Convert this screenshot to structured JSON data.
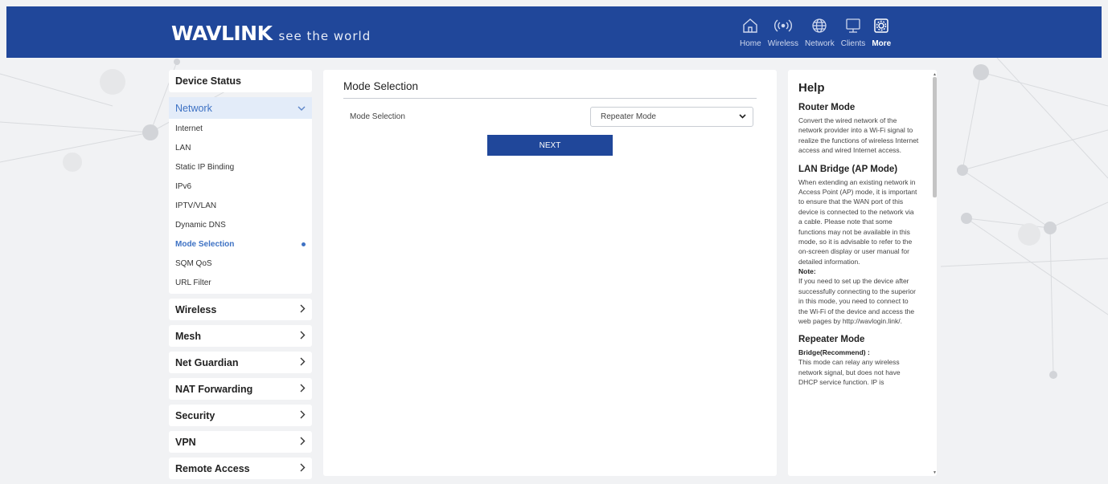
{
  "header": {
    "brand": "WAVLINK",
    "tagline": "see the world",
    "nav": [
      {
        "label": "Home",
        "icon": "home-icon"
      },
      {
        "label": "Wireless",
        "icon": "wireless-icon"
      },
      {
        "label": "Network",
        "icon": "globe-icon"
      },
      {
        "label": "Clients",
        "icon": "monitor-icon"
      },
      {
        "label": "More",
        "icon": "settings-icon"
      }
    ],
    "active_nav": "More"
  },
  "sidebar": {
    "device_status": "Device Status",
    "network": {
      "label": "Network",
      "items": [
        "Internet",
        "LAN",
        "Static IP Binding",
        "IPv6",
        "IPTV/VLAN",
        "Dynamic DNS",
        "Mode Selection",
        "SQM QoS",
        "URL Filter"
      ],
      "active": "Mode Selection"
    },
    "sections": [
      "Wireless",
      "Mesh",
      "Net Guardian",
      "NAT Forwarding",
      "Security",
      "VPN",
      "Remote Access"
    ]
  },
  "main": {
    "title": "Mode Selection",
    "field_label": "Mode Selection",
    "selected_mode": "Repeater Mode",
    "next_label": "NEXT"
  },
  "help": {
    "title": "Help",
    "router_title": "Router Mode",
    "router_text": "Convert the wired network of the network provider into a Wi-Fi signal to realize the functions of wireless Internet access and wired Internet access.",
    "bridge_title": "LAN Bridge (AP Mode)",
    "bridge_text": "When extending an existing network in Access Point (AP) mode, it is important to ensure that the WAN port of this device is connected to the network via a cable. Please note that some functions may not be available in this mode, so it is advisable to refer to the on-screen display or user manual for detailed information.",
    "note_label": "Note:",
    "note_text": "If you need to set up the device after successfully connecting to the superior in this mode, you need to connect to the Wi-Fi of the device and access the web pages by http://wavlogin.link/.",
    "repeater_title": "Repeater Mode",
    "repeater_sub": "Bridge(Recommend) :",
    "repeater_text": "This mode can relay any wireless network signal, but does not have DHCP service function. IP is"
  },
  "colors": {
    "header": "#20479a",
    "accent": "#3e72c4",
    "page_bg": "#f1f2f4"
  }
}
